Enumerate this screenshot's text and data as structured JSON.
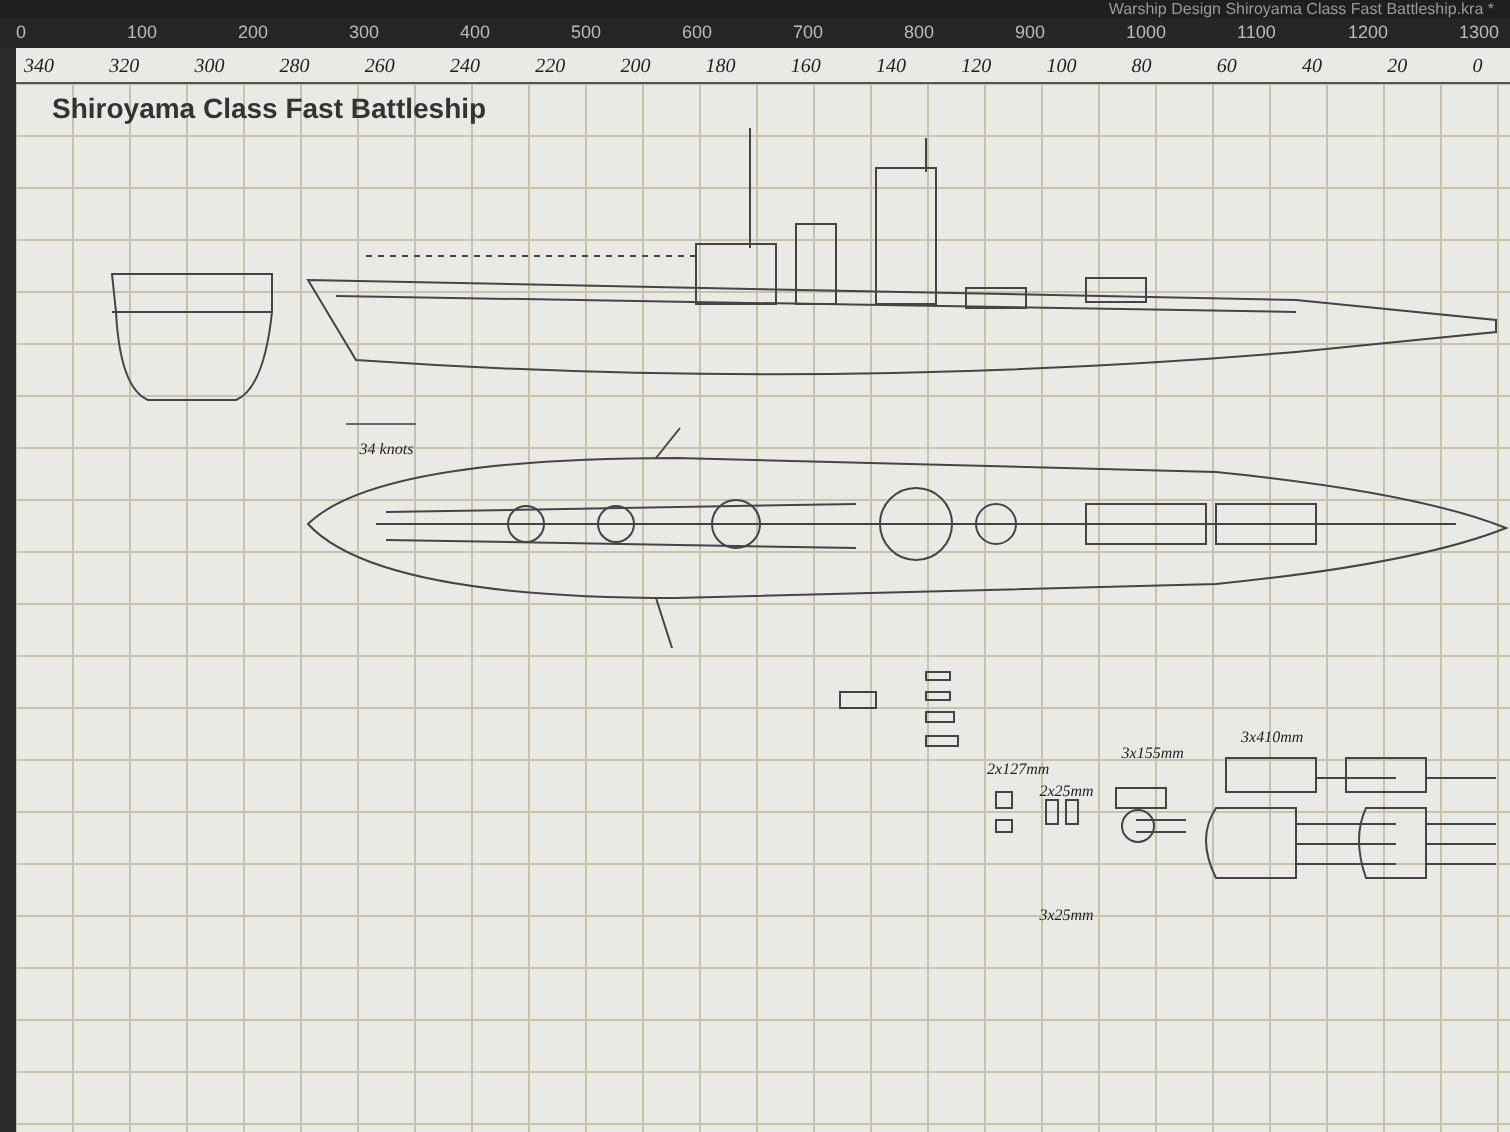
{
  "window": {
    "title": "Warship Design Shiroyama Class Fast Battleship.kra *"
  },
  "ruler": {
    "labels": [
      "0",
      "100",
      "200",
      "300",
      "400",
      "500",
      "600",
      "700",
      "800",
      "900",
      "1000",
      "1100",
      "1200",
      "1300"
    ]
  },
  "scale_marks": [
    "340",
    "320",
    "300",
    "280",
    "260",
    "240",
    "220",
    "200",
    "180",
    "160",
    "140",
    "120",
    "100",
    "80",
    "60",
    "40",
    "20",
    "0"
  ],
  "drawing": {
    "title": "Shiroyama Class Fast Battleship",
    "notes": [
      "34 knots",
      "2x127mm",
      "2x25mm",
      "3x25mm",
      "3x155mm",
      "3x410mm"
    ]
  }
}
